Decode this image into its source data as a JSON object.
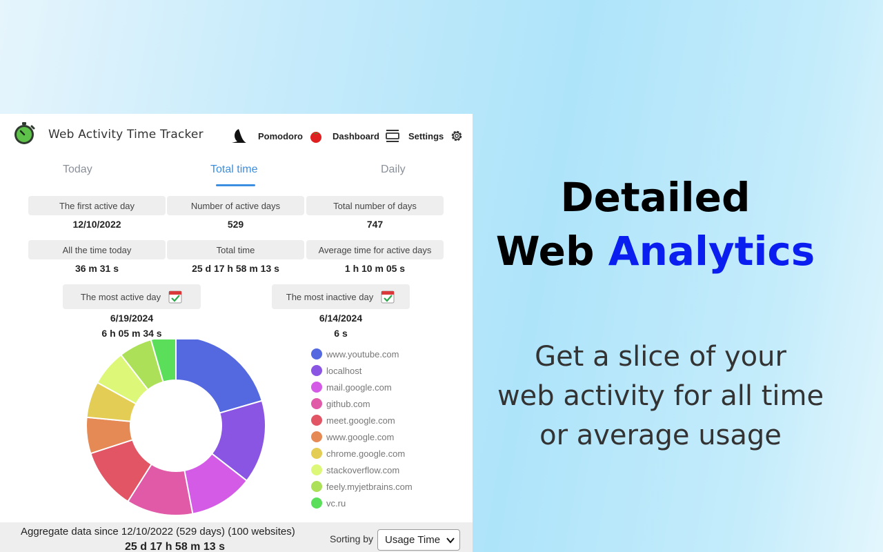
{
  "header": {
    "app_title": "Web Activity Time Tracker",
    "pomodoro_label": "Pomodoro",
    "dashboard_label": "Dashboard",
    "settings_label": "Settings"
  },
  "tabs": [
    {
      "label": "Today"
    },
    {
      "label": "Total time",
      "active": true
    },
    {
      "label": "Daily"
    }
  ],
  "stats": [
    {
      "label": "The first active day",
      "value": "12/10/2022"
    },
    {
      "label": "Number of active days",
      "value": "529"
    },
    {
      "label": "Total number of days",
      "value": "747"
    },
    {
      "label": "All the time today",
      "value": "36 m 31 s"
    },
    {
      "label": "Total time",
      "value": "25 d 17 h 58 m 13 s"
    },
    {
      "label": "Average time for active days",
      "value": "1 h 10 m 05 s"
    }
  ],
  "most_active": {
    "label": "The most active day",
    "date": "6/19/2024",
    "time": "6 h 05 m 34 s"
  },
  "most_inactive": {
    "label": "The most inactive day",
    "date": "6/14/2024",
    "time": "6 s"
  },
  "chart_data": {
    "type": "pie",
    "donut": true,
    "slices": [
      {
        "label": "www.youtube.com",
        "value": 20.5,
        "color": "#5468e0"
      },
      {
        "label": "localhost",
        "value": 15.0,
        "color": "#8a55e3"
      },
      {
        "label": "mail.google.com",
        "value": 11.5,
        "color": "#d35be6"
      },
      {
        "label": "github.com",
        "value": 12.0,
        "color": "#e05aa8"
      },
      {
        "label": "meet.google.com",
        "value": 11.0,
        "color": "#e25565"
      },
      {
        "label": "www.google.com",
        "value": 6.5,
        "color": "#e68a55"
      },
      {
        "label": "chrome.google.com",
        "value": 6.5,
        "color": "#e3cd55"
      },
      {
        "label": "stackoverflow.com",
        "value": 6.5,
        "color": "#ddf878"
      },
      {
        "label": "feely.myjetbrains.com",
        "value": 6.0,
        "color": "#abe058"
      },
      {
        "label": "vc.ru",
        "value": 4.5,
        "color": "#5bdf5b"
      }
    ]
  },
  "footer": {
    "aggregate_text": "Aggregate data since 12/10/2022 (529 days) (100 websites)",
    "total": "25 d 17 h 58 m 13 s",
    "sort_label": "Sorting by",
    "sort_value": "Usage Time"
  },
  "promo": {
    "title_line1": "Detailed",
    "title_line2_plain": "Web",
    "title_line2_accent": "Analytics",
    "sub_line1": "Get a slice of your",
    "sub_line2": "web activity for all time",
    "sub_line3": "or average usage"
  }
}
